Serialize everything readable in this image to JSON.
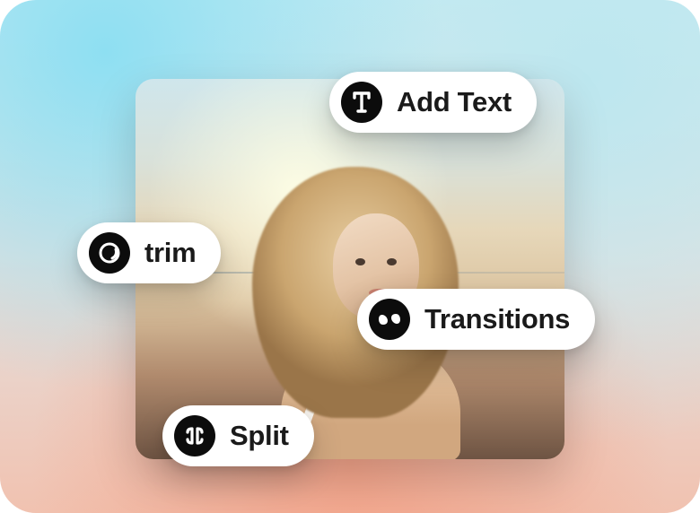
{
  "actions": {
    "add_text": {
      "label": "Add Text",
      "icon": "text-icon"
    },
    "trim": {
      "label": "trim",
      "icon": "trim-icon"
    },
    "transitions": {
      "label": "Transitions",
      "icon": "transitions-icon"
    },
    "split": {
      "label": "Split",
      "icon": "split-icon"
    }
  }
}
